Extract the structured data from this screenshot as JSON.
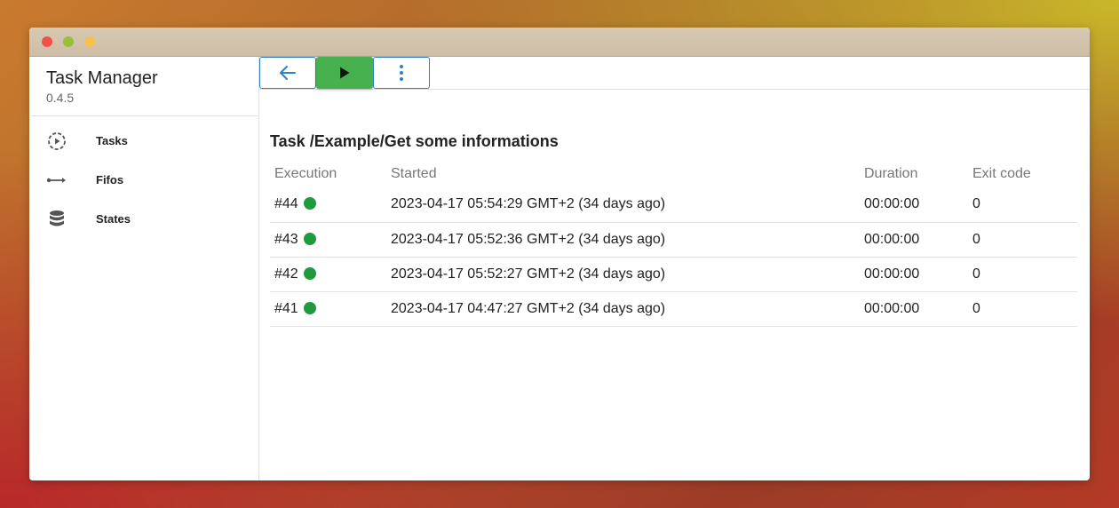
{
  "app": {
    "title": "Task Manager",
    "version": "0.4.5"
  },
  "sidebar": {
    "items": [
      {
        "label": "Tasks",
        "icon": "play-circle-icon"
      },
      {
        "label": "Fifos",
        "icon": "fifo-arrow-icon"
      },
      {
        "label": "States",
        "icon": "database-icon"
      }
    ]
  },
  "toolbar": {
    "back_icon": "arrow-left-icon",
    "run_icon": "play-icon",
    "more_icon": "more-vertical-icon"
  },
  "task": {
    "heading": "Task /Example/Get some informations"
  },
  "table": {
    "headers": [
      "Execution",
      "Started",
      "Duration",
      "Exit code"
    ],
    "rows": [
      {
        "execution": "#44",
        "started": "2023-04-17 05:54:29 GMT+2 (34 days ago)",
        "duration": "00:00:00",
        "exit_code": "0"
      },
      {
        "execution": "#43",
        "started": "2023-04-17 05:52:36 GMT+2 (34 days ago)",
        "duration": "00:00:00",
        "exit_code": "0"
      },
      {
        "execution": "#42",
        "started": "2023-04-17 05:52:27 GMT+2 (34 days ago)",
        "duration": "00:00:00",
        "exit_code": "0"
      },
      {
        "execution": "#41",
        "started": "2023-04-17 04:47:27 GMT+2 (34 days ago)",
        "duration": "00:00:00",
        "exit_code": "0"
      }
    ]
  },
  "colors": {
    "accent": "#2f7fc8",
    "run": "#47b04f",
    "success": "#1f9a3c"
  }
}
